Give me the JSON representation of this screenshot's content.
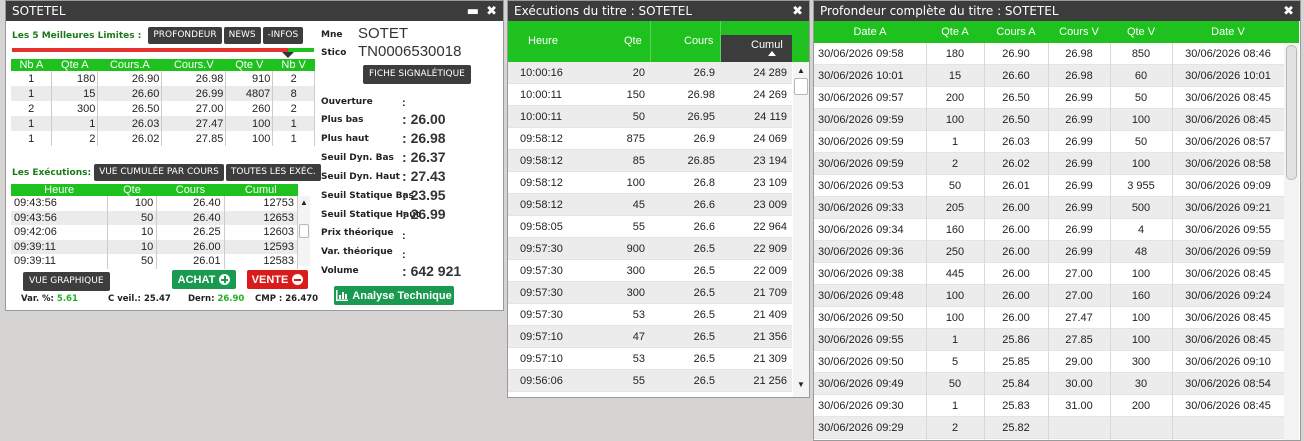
{
  "win1": {
    "title": "SOTETEL",
    "best_label": "Les 5 Meilleures Limites :",
    "buttons": {
      "profondeur": "PROFONDEUR",
      "news": "NEWS",
      "infos": "-INFOS"
    },
    "best_cols": [
      "Nb A",
      "Qte A",
      "Cours.A",
      "Cours.V",
      "Qte V",
      "Nb V"
    ],
    "best_rows": [
      [
        "1",
        "180",
        "26.90",
        "26.98",
        "910",
        "2"
      ],
      [
        "1",
        "15",
        "26.60",
        "26.99",
        "4807",
        "8"
      ],
      [
        "2",
        "300",
        "26.50",
        "27.00",
        "260",
        "2"
      ],
      [
        "1",
        "1",
        "26.03",
        "27.47",
        "100",
        "1"
      ],
      [
        "1",
        "2",
        "26.02",
        "27.85",
        "100",
        "1"
      ]
    ],
    "exec_label": "Les Exécutions:",
    "exec_buttons": {
      "cumul": "VUE CUMULÉE PAR COURS",
      "all": "TOUTES LES EXÉC."
    },
    "exec_cols": [
      "Heure",
      "Qte",
      "Cours",
      "Cumul"
    ],
    "exec_rows": [
      [
        "09:43:56",
        "100",
        "26.40",
        "12753"
      ],
      [
        "09:43:56",
        "50",
        "26.40",
        "12653"
      ],
      [
        "09:42:06",
        "10",
        "26.25",
        "12603"
      ],
      [
        "09:39:11",
        "10",
        "26.00",
        "12593"
      ],
      [
        "09:39:11",
        "50",
        "26.01",
        "12583"
      ]
    ],
    "vue_graphique": "VUE GRAPHIQUE",
    "achat": "ACHAT",
    "vente": "VENTE",
    "stats": {
      "var_label": "Var. %:",
      "var_value": "5.61",
      "cveil_label": "C veil.:",
      "cveil_value": "25.47",
      "dern_label": "Dern:",
      "dern_value": "26.90",
      "cmp_label": "CMP :",
      "cmp_value": "26.470"
    },
    "info": {
      "mne_label": "Mne",
      "mne_value": "SOTET",
      "stico_label": "Stico",
      "stico_value": "TN0006530018",
      "fiche": "FICHE SIGNALÉTIQUE",
      "rows": [
        {
          "label": "Ouverture",
          "value": ""
        },
        {
          "label": "Plus bas",
          "value": "26.00"
        },
        {
          "label": "Plus haut",
          "value": "26.98"
        },
        {
          "label": "Seuil Dyn. Bas",
          "value": "26.37"
        },
        {
          "label": "Seuil Dyn. Haut",
          "value": "27.43"
        },
        {
          "label": "Seuil Statique Bas",
          "value": "23.95"
        },
        {
          "label": "Seuil Statique Haut",
          "value": "26.99"
        },
        {
          "label": "Prix théorique",
          "value": ""
        },
        {
          "label": "Var. théorique",
          "value": ""
        },
        {
          "label": "Volume",
          "value": "642 921"
        }
      ],
      "analyse": "Analyse Technique"
    }
  },
  "win2": {
    "title": "Exécutions du titre : SOTETEL",
    "cols": [
      "Heure",
      "Qte",
      "Cours",
      "Cumul"
    ],
    "rows": [
      [
        "10:00:16",
        "20",
        "26.9",
        "24 289"
      ],
      [
        "10:00:11",
        "150",
        "26.98",
        "24 269"
      ],
      [
        "10:00:11",
        "50",
        "26.95",
        "24 119"
      ],
      [
        "09:58:12",
        "875",
        "26.9",
        "24 069"
      ],
      [
        "09:58:12",
        "85",
        "26.85",
        "23 194"
      ],
      [
        "09:58:12",
        "100",
        "26.8",
        "23 109"
      ],
      [
        "09:58:12",
        "45",
        "26.6",
        "23 009"
      ],
      [
        "09:58:05",
        "55",
        "26.6",
        "22 964"
      ],
      [
        "09:57:30",
        "900",
        "26.5",
        "22 909"
      ],
      [
        "09:57:30",
        "300",
        "26.5",
        "22 009"
      ],
      [
        "09:57:30",
        "300",
        "26.5",
        "21 709"
      ],
      [
        "09:57:30",
        "53",
        "26.5",
        "21 409"
      ],
      [
        "09:57:10",
        "47",
        "26.5",
        "21 356"
      ],
      [
        "09:57:10",
        "53",
        "26.5",
        "21 309"
      ],
      [
        "09:56:06",
        "55",
        "26.5",
        "21 256"
      ]
    ]
  },
  "win3": {
    "title": "Profondeur complète du titre : SOTETEL",
    "cols": [
      "Date A",
      "Qte A",
      "Cours A",
      "Cours V",
      "Qte V",
      "Date V"
    ],
    "rows": [
      [
        "30/06/2026 09:58",
        "180",
        "26.90",
        "26.98",
        "850",
        "30/06/2026 08:46"
      ],
      [
        "30/06/2026 10:01",
        "15",
        "26.60",
        "26.98",
        "60",
        "30/06/2026 10:01"
      ],
      [
        "30/06/2026 09:57",
        "200",
        "26.50",
        "26.99",
        "50",
        "30/06/2026 08:45"
      ],
      [
        "30/06/2026 09:59",
        "100",
        "26.50",
        "26.99",
        "100",
        "30/06/2026 08:45"
      ],
      [
        "30/06/2026 09:59",
        "1",
        "26.03",
        "26.99",
        "50",
        "30/06/2026 08:57"
      ],
      [
        "30/06/2026 09:59",
        "2",
        "26.02",
        "26.99",
        "100",
        "30/06/2026 08:58"
      ],
      [
        "30/06/2026 09:53",
        "50",
        "26.01",
        "26.99",
        "3 955",
        "30/06/2026 09:09"
      ],
      [
        "30/06/2026 09:33",
        "205",
        "26.00",
        "26.99",
        "500",
        "30/06/2026 09:21"
      ],
      [
        "30/06/2026 09:34",
        "160",
        "26.00",
        "26.99",
        "4",
        "30/06/2026 09:55"
      ],
      [
        "30/06/2026 09:36",
        "250",
        "26.00",
        "26.99",
        "48",
        "30/06/2026 09:59"
      ],
      [
        "30/06/2026 09:38",
        "445",
        "26.00",
        "27.00",
        "100",
        "30/06/2026 08:45"
      ],
      [
        "30/06/2026 09:48",
        "100",
        "26.00",
        "27.00",
        "160",
        "30/06/2026 09:24"
      ],
      [
        "30/06/2026 09:50",
        "100",
        "26.00",
        "27.47",
        "100",
        "30/06/2026 08:45"
      ],
      [
        "30/06/2026 09:55",
        "1",
        "25.86",
        "27.85",
        "100",
        "30/06/2026 08:45"
      ],
      [
        "30/06/2026 09:50",
        "5",
        "25.85",
        "29.00",
        "300",
        "30/06/2026 09:10"
      ],
      [
        "30/06/2026 09:49",
        "50",
        "25.84",
        "30.00",
        "30",
        "30/06/2026 08:54"
      ],
      [
        "30/06/2026 09:30",
        "1",
        "25.83",
        "31.00",
        "200",
        "30/06/2026 08:45"
      ],
      [
        "30/06/2026 09:29",
        "2",
        "25.82",
        "",
        "",
        ""
      ]
    ]
  }
}
